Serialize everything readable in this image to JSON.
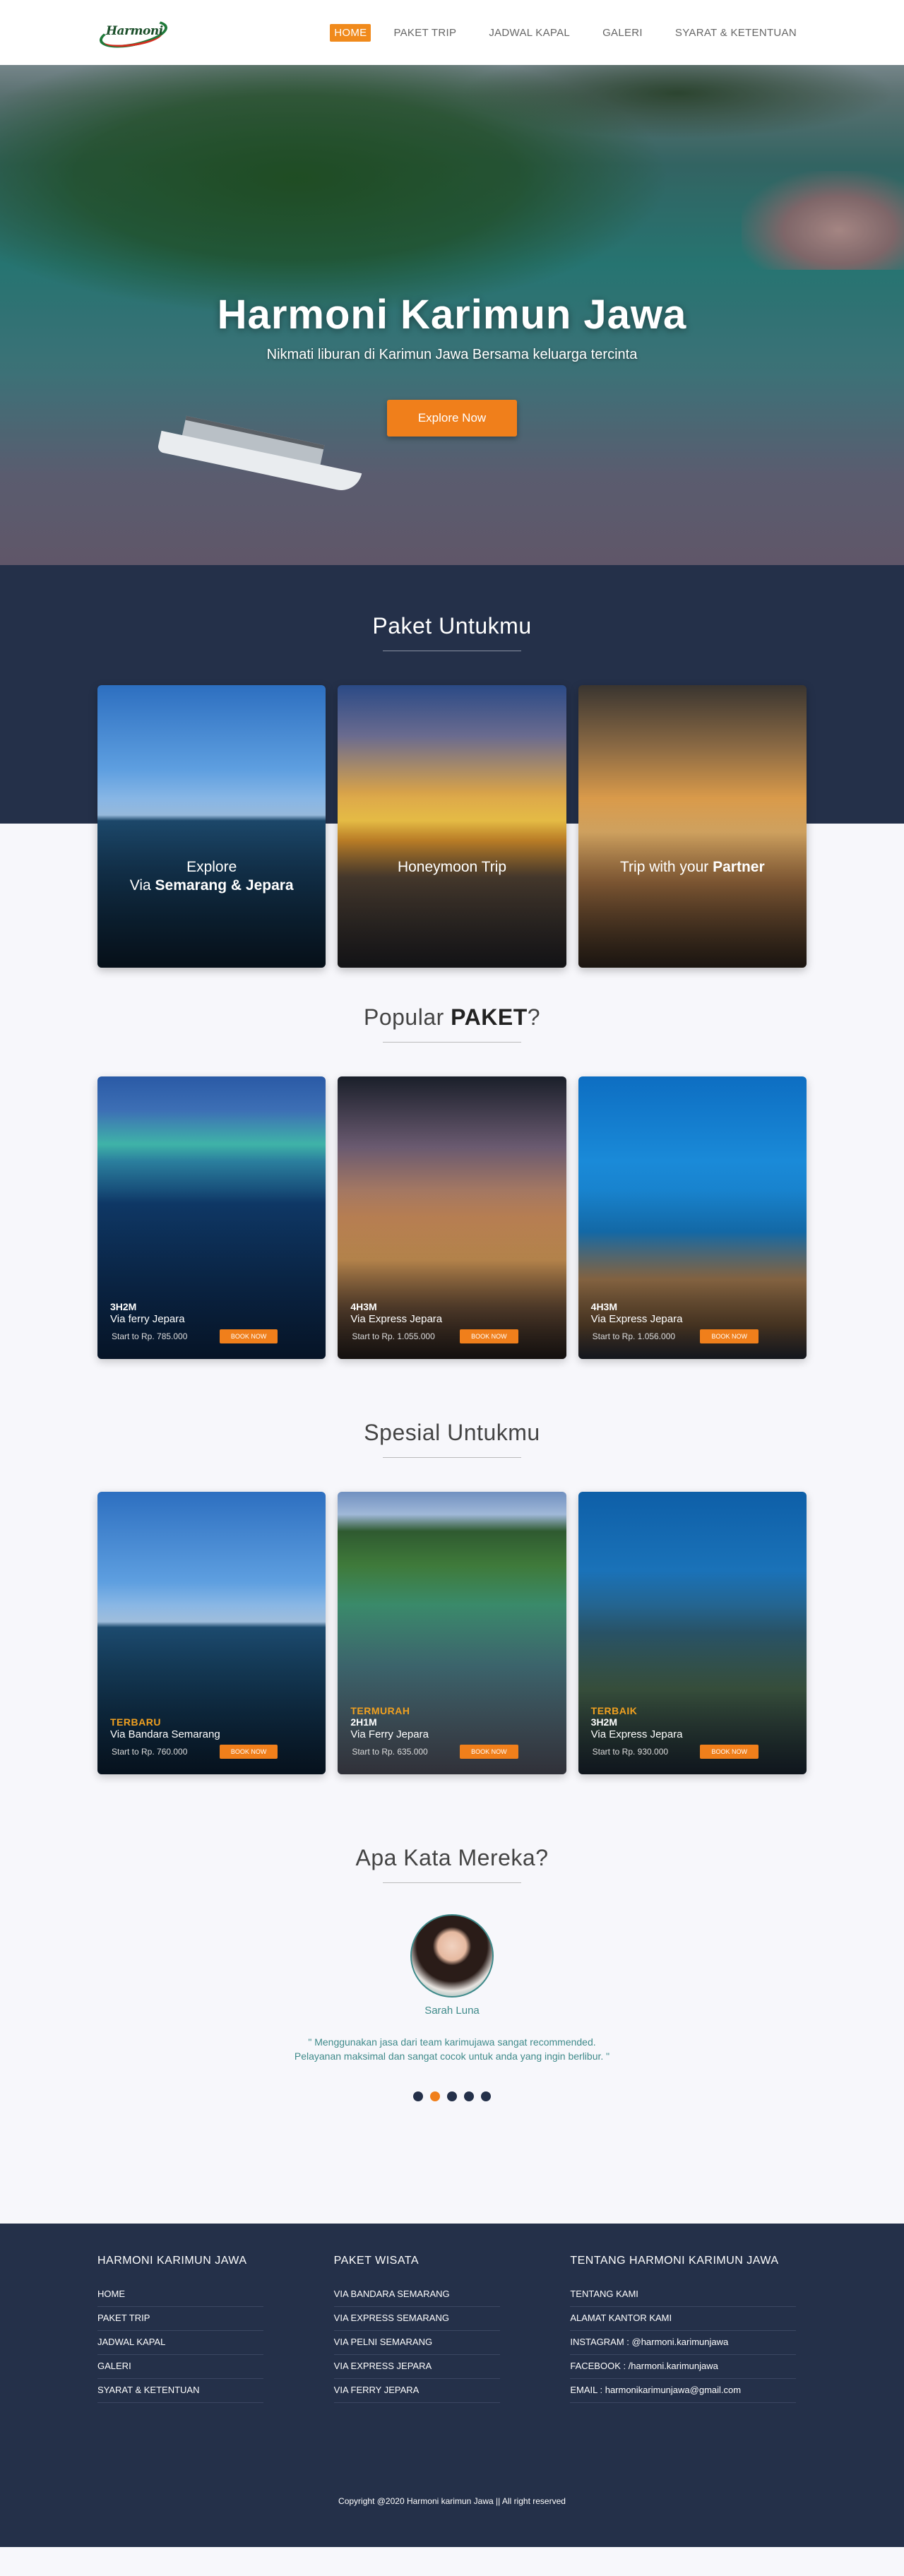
{
  "nav": {
    "logo_text": "Harmoni",
    "links": [
      "HOME",
      "PAKET TRIP",
      "JADWAL KAPAL",
      "GALERI",
      "SYARAT & KETENTUAN"
    ]
  },
  "hero": {
    "title": "Harmoni Karimun Jawa",
    "subtitle": "Nikmati liburan di Karimun Jawa Bersama keluarga tercinta",
    "button": "Explore Now"
  },
  "paket": {
    "title": "Paket Untukmu",
    "cards": [
      {
        "line1": "Explore",
        "line2_prefix": "Via ",
        "line2_bold": "Semarang & Jepara"
      },
      {
        "line1": "Honeymoon Trip",
        "line2_prefix": "",
        "line2_bold": ""
      },
      {
        "line1": "Trip with your ",
        "line2_prefix": "",
        "line2_bold": "Partner"
      }
    ]
  },
  "popular": {
    "title_prefix": "Popular ",
    "title_bold": "PAKET",
    "title_suffix": "?",
    "cards": [
      {
        "duration": "3H2M",
        "route": "Via ferry Jepara",
        "price": "Start to Rp. 785.000",
        "button": "BOOK NOW"
      },
      {
        "duration": "4H3M",
        "route": "Via Express Jepara",
        "price": "Start to Rp. 1.055.000",
        "button": "BOOK NOW"
      },
      {
        "duration": "4H3M",
        "route": "Via Express Jepara",
        "price": "Start to Rp. 1.056.000",
        "button": "BOOK NOW"
      }
    ]
  },
  "spesial": {
    "title": "Spesial Untukmu",
    "cards": [
      {
        "tag": "TERBARU",
        "duration": "",
        "route": "Via Bandara Semarang",
        "price": "Start to Rp. 760.000",
        "button": "BOOK NOW"
      },
      {
        "tag": "TERMURAH",
        "duration": "2H1M",
        "route": "Via Ferry Jepara",
        "price": "Start to Rp. 635.000",
        "button": "BOOK NOW"
      },
      {
        "tag": "TERBAIK",
        "duration": "3H2M",
        "route": "Via Express Jepara",
        "price": "Start to Rp. 930.000",
        "button": "BOOK NOW"
      }
    ]
  },
  "testimonial": {
    "title": "Apa Kata Mereka?",
    "name": "Sarah Luna",
    "quote_line1": "\" Menggunakan jasa dari team karimujawa sangat recommended.",
    "quote_line2": "Pelayanan maksimal dan sangat cocok untuk anda yang ingin berlibur. \"",
    "dots": 5,
    "active_dot": 1
  },
  "footer": {
    "col1": {
      "title": "HARMONI KARIMUN JAWA",
      "links": [
        "HOME",
        "PAKET TRIP",
        "JADWAL KAPAL",
        "GALERI",
        "SYARAT & KETENTUAN"
      ]
    },
    "col2": {
      "title": "PAKET WISATA",
      "links": [
        "VIA BANDARA SEMARANG",
        "VIA EXPRESS SEMARANG",
        "VIA PELNI SEMARANG",
        "VIA EXPRESS JEPARA",
        "VIA FERRY JEPARA"
      ]
    },
    "col3": {
      "title": "TENTANG HARMONI KARIMUN JAWA",
      "links": [
        "TENTANG KAMI",
        "ALAMAT KANTOR KAMI",
        "INSTAGRAM : @harmoni.karimunjawa",
        "FACEBOOK : /harmoni.karimunjawa",
        "EMAIL : harmonikarimunjawa@gmail.com"
      ]
    },
    "copyright": "Copyright @2020 Harmoni karimun Jawa || All right reserved"
  },
  "colors": {
    "accent": "#f07f1b",
    "navy": "#243049",
    "teal": "#3f8a8a"
  }
}
